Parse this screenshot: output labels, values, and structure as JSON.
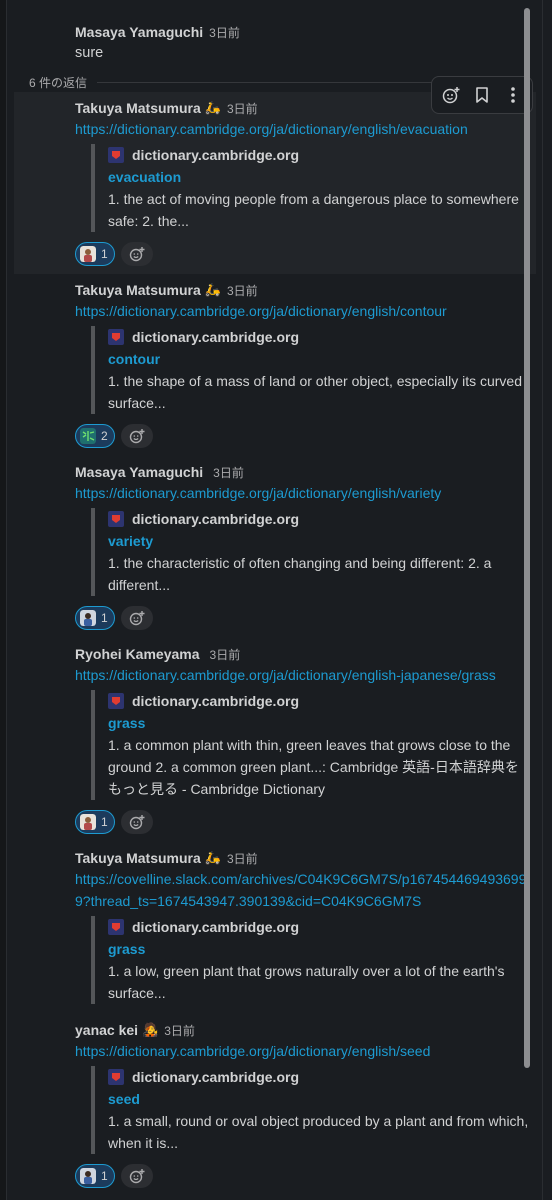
{
  "thread": {
    "parent": {
      "author": "Masaya Yamaguchi",
      "time": "3日前",
      "text": "sure"
    },
    "reply_count_label": "6 件の返信",
    "toolbar": {
      "add_reaction_icon": "add-reaction-icon",
      "bookmark_icon": "bookmark-icon",
      "more_icon": "more-vertical-icon"
    },
    "replies": [
      {
        "author": "Takuya Matsumura",
        "status_emoji": "🛵",
        "time": "3日前",
        "link": "https://dictionary.cambridge.org/ja/dictionary/english/evacuation",
        "unfurl": {
          "site": "dictionary.cambridge.org",
          "title": "evacuation",
          "desc": "1. the act of moving people from a dangerous place to somewhere safe: 2. the..."
        },
        "reaction_count": "1"
      },
      {
        "author": "Takuya Matsumura",
        "status_emoji": "🛵",
        "time": "3日前",
        "link": "https://dictionary.cambridge.org/ja/dictionary/english/contour",
        "unfurl": {
          "site": "dictionary.cambridge.org",
          "title": "contour",
          "desc": "1. the shape of a mass of land or other object, especially its curved surface..."
        },
        "reaction_count": "2"
      },
      {
        "author": "Masaya Yamaguchi",
        "status_emoji": "",
        "time": "3日前",
        "link": "https://dictionary.cambridge.org/ja/dictionary/english/variety",
        "unfurl": {
          "site": "dictionary.cambridge.org",
          "title": "variety",
          "desc": "1. the characteristic of often changing and being different: 2. a different..."
        },
        "reaction_count": "1"
      },
      {
        "author": "Ryohei Kameyama",
        "status_emoji": "",
        "time": "3日前",
        "link": "https://dictionary.cambridge.org/ja/dictionary/english-japanese/grass",
        "unfurl": {
          "site": "dictionary.cambridge.org",
          "title": "grass",
          "desc": "1. a common plant with thin, green leaves that grows close to the ground 2. a common green plant...: Cambridge 英語-日本語辞典をもっと見る - Cambridge Dictionary"
        },
        "reaction_count": "1"
      },
      {
        "author": "Takuya Matsumura",
        "status_emoji": "🛵",
        "time": "3日前",
        "link": "https://covelline.slack.com/archives/C04K9C6GM7S/p1674544694936999?thread_ts=1674543947.390139&cid=C04K9C6GM7S",
        "unfurl": {
          "site": "dictionary.cambridge.org",
          "title": "grass",
          "desc": "1. a low, green plant that grows naturally over a lot of the earth's surface..."
        },
        "reaction_count": ""
      },
      {
        "author": "yanac kei",
        "status_emoji": "🧑‍🎤",
        "time": "3日前",
        "link": "https://dictionary.cambridge.org/ja/dictionary/english/seed",
        "unfurl": {
          "site": "dictionary.cambridge.org",
          "title": "seed",
          "desc": "1. a small, round or oval object produced by a plant and from which, when it is..."
        },
        "reaction_count": "1"
      }
    ]
  },
  "colors": {
    "background": "#1a1d21",
    "link": "#1d9bd1",
    "reaction_bg": "#1c3b5c"
  }
}
